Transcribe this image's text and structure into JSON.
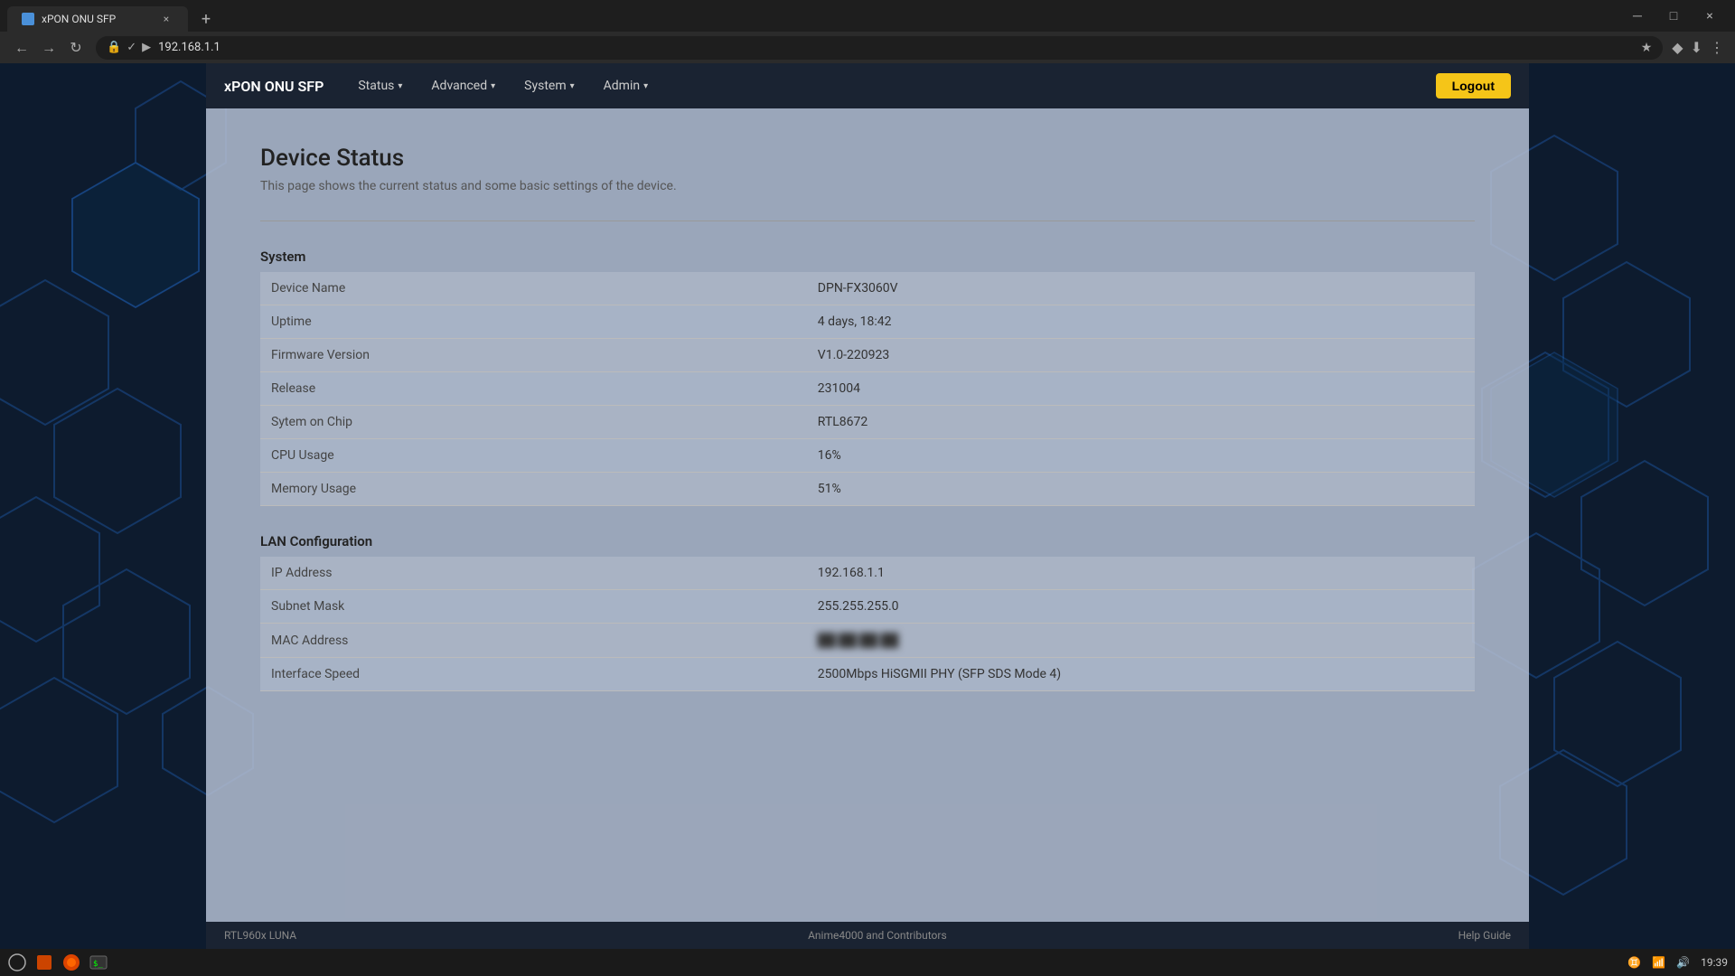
{
  "browser": {
    "tab": {
      "title": "xPON ONU SFP",
      "close_label": "×"
    },
    "new_tab_label": "+",
    "address": "192.168.1.1",
    "window_controls": {
      "minimize": "─",
      "maximize": "□",
      "close": "×"
    }
  },
  "navbar": {
    "brand": "xPON ONU SFP",
    "items": [
      {
        "label": "Status",
        "chevron": "▾"
      },
      {
        "label": "Advanced",
        "chevron": "▾"
      },
      {
        "label": "System",
        "chevron": "▾"
      },
      {
        "label": "Admin",
        "chevron": "▾"
      }
    ],
    "logout_label": "Logout"
  },
  "page": {
    "title": "Device Status",
    "subtitle": "This page shows the current status and some basic settings of the device."
  },
  "system_section": {
    "title": "System",
    "rows": [
      {
        "label": "Device Name",
        "value": "DPN-FX3060V"
      },
      {
        "label": "Uptime",
        "value": "4 days, 18:42"
      },
      {
        "label": "Firmware Version",
        "value": "V1.0-220923"
      },
      {
        "label": "Release",
        "value": "231004"
      },
      {
        "label": "Sytem on Chip",
        "value": "RTL8672"
      },
      {
        "label": "CPU Usage",
        "value": "16%"
      },
      {
        "label": "Memory Usage",
        "value": "51%"
      }
    ]
  },
  "lan_section": {
    "title": "LAN Configuration",
    "rows": [
      {
        "label": "IP Address",
        "value": "192.168.1.1"
      },
      {
        "label": "Subnet Mask",
        "value": "255.255.255.0"
      },
      {
        "label": "MAC Address",
        "value": "██:██:██:██",
        "blurred": true
      },
      {
        "label": "Interface Speed",
        "value": "2500Mbps HiSGMII PHY (SFP SDS Mode 4)"
      }
    ]
  },
  "footer": {
    "left": "RTL960x LUNA",
    "center": "Anime4000 and Contributors",
    "right": "Help Guide"
  },
  "taskbar": {
    "time": "19:39"
  }
}
